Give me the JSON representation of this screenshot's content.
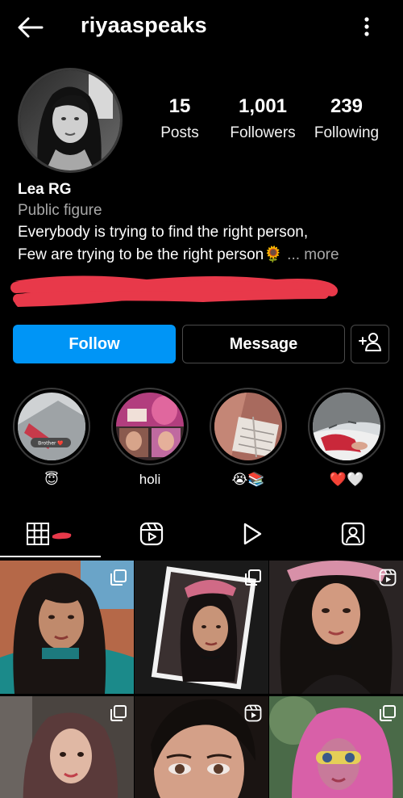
{
  "header": {
    "username": "riyaaspeaks",
    "back_icon": "arrow-left-icon",
    "menu_icon": "vertical-ellipsis-icon"
  },
  "stats": {
    "posts": {
      "value": "15",
      "label": "Posts"
    },
    "followers": {
      "value": "1,001",
      "label": "Followers"
    },
    "following": {
      "value": "239",
      "label": "Following"
    }
  },
  "bio": {
    "name": "Lea RG",
    "category": "Public figure",
    "line1": "Everybody is trying to find the right person,",
    "line2": "Few are trying to be the right person",
    "line2_emoji": "🌻",
    "more": " ... more"
  },
  "actions": {
    "follow_label": "Follow",
    "message_label": "Message",
    "add_user_icon": "add-person-icon"
  },
  "highlights": [
    {
      "label": "😇",
      "sticker_text": "Brother ❤️"
    },
    {
      "label": "holi"
    },
    {
      "label": "😭📚"
    },
    {
      "label": "❤️🤍"
    }
  ],
  "tabs": [
    {
      "icon": "grid-icon",
      "active": true
    },
    {
      "icon": "reels-icon",
      "active": false
    },
    {
      "icon": "play-icon",
      "active": false
    },
    {
      "icon": "tagged-person-icon",
      "active": false
    }
  ],
  "grid_posts": [
    {
      "badge": "carousel-icon"
    },
    {
      "badge": "carousel-icon"
    },
    {
      "badge": "reels-icon"
    },
    {
      "badge": "carousel-icon"
    },
    {
      "badge": "reels-icon"
    },
    {
      "badge": "carousel-icon"
    }
  ],
  "colors": {
    "background": "#000000",
    "follow_button": "#0095f6",
    "muted_text": "#a8a8a8",
    "button_border": "#4a4a4a",
    "redaction": "#e8394a"
  }
}
